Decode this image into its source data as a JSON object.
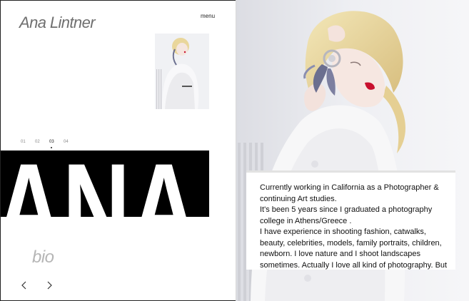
{
  "header": {
    "site_title": "Ana Lintner",
    "menu_label": "menu"
  },
  "slides": {
    "items": [
      "01",
      "02",
      "03",
      "04"
    ],
    "active_index": 2
  },
  "hero": {
    "word": "ANA"
  },
  "bio": {
    "label": "bio",
    "text": "Currently working in California as a Photographer & continuing Art studies.\nIt's been 5 years since I graduated a photography college in Athens/Greece .\nI have experience in shooting fashion, catwalks, beauty, celebrities, models, family portraits, children, newborn. I love nature and I shoot landscapes sometimes. Actually I love all kind of photography. But mostly I prefer to work"
  },
  "thumbnail": {
    "caption": "■ ■ ■ ■"
  },
  "colors": {
    "title_gray": "#6f6f6f",
    "bio_gray": "#b5b5b5",
    "lipstick": "#c8102e",
    "band_black": "#000000"
  },
  "icons": {
    "prev": "chevron-left-icon",
    "next": "chevron-right-icon"
  }
}
